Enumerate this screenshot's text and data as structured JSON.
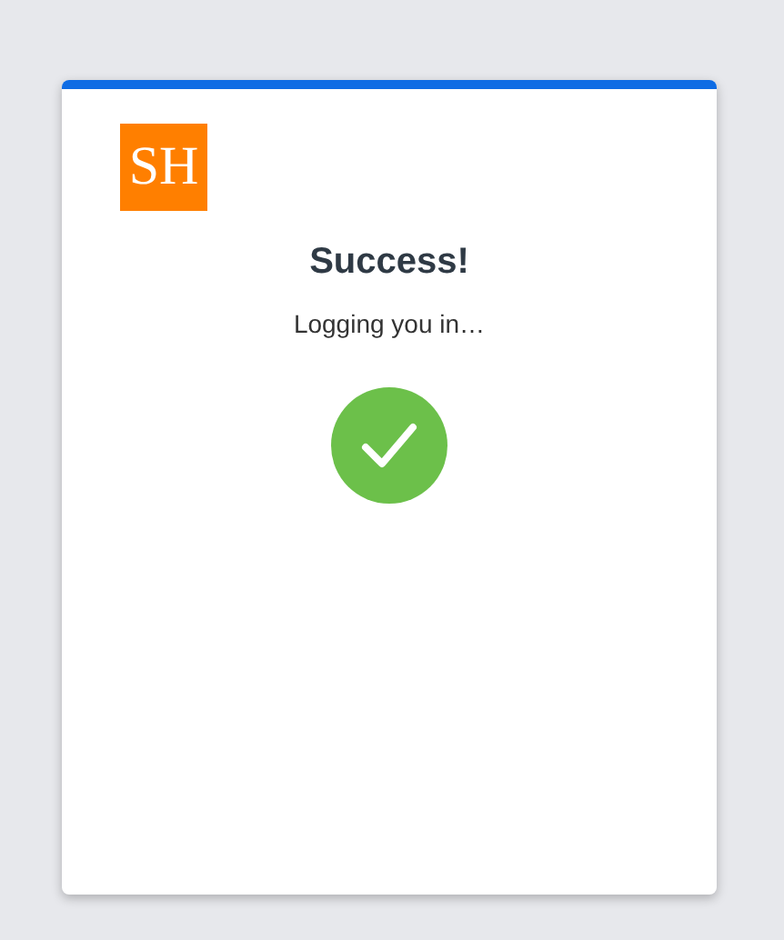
{
  "logo": {
    "text": "SH"
  },
  "title": "Success!",
  "message": "Logging you in…",
  "status": {
    "kind": "success"
  }
}
